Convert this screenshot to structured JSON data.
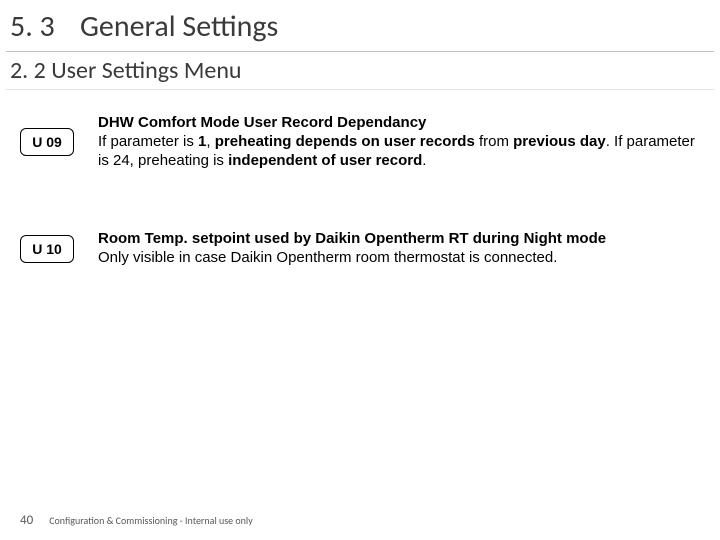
{
  "header": {
    "section_number": "5. 3",
    "section_title": "General Settings"
  },
  "subheading": "2. 2 User Settings Menu",
  "items": [
    {
      "code": "U 09",
      "title": "DHW Comfort Mode User Record Dependancy",
      "body_html": "If parameter is <b>1</b>, <b>preheating depends on user records</b> from <b>previous day</b>. If parameter is 24, preheating is <b>independent of user record</b>."
    },
    {
      "code": "U 10",
      "title": "Room Temp. setpoint used by Daikin Opentherm RT during Night mode",
      "body_html": "Only visible in case Daikin Opentherm room thermostat is connected."
    }
  ],
  "footer": {
    "page": "40",
    "text": "Configuration & Commissioning - Internal use only"
  }
}
